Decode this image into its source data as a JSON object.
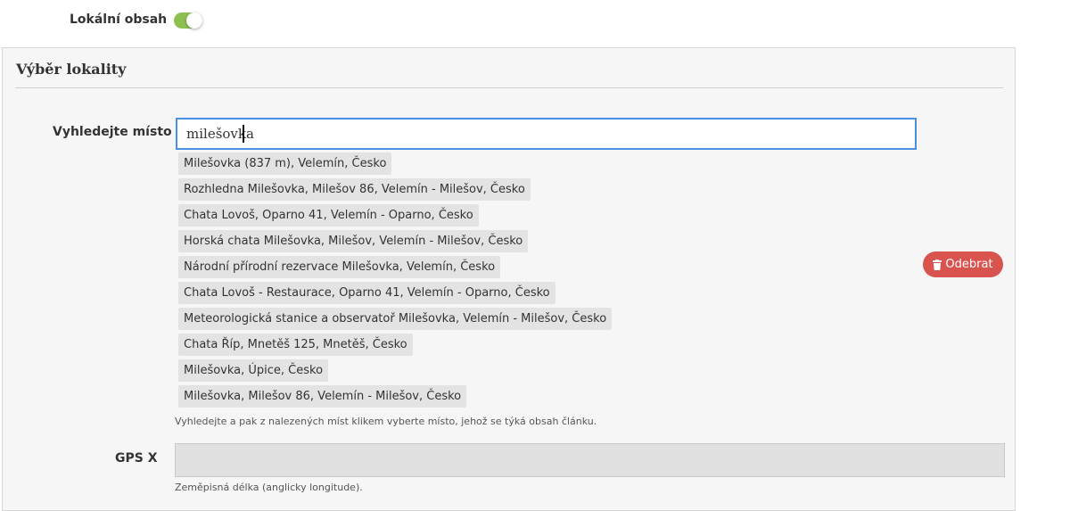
{
  "local_content": {
    "label": "Lokální obsah",
    "enabled": true,
    "accent": "#8cc152"
  },
  "panel": {
    "title": "Výběr lokality"
  },
  "search": {
    "label": "Vyhledejte místo",
    "value": "milešovka",
    "accent": "#4a90e2",
    "suggestions": [
      "Milešovka (837 m), Velemín, Česko",
      "Rozhledna Milešovka, Milešov 86, Velemín - Milešov, Česko",
      "Chata Lovoš, Oparno 41, Velemín - Oparno, Česko",
      "Horská chata Milešovka, Milešov, Velemín - Milešov, Česko",
      "Národní přírodní rezervace Milešovka, Velemín, Česko",
      "Chata Lovoš - Restaurace, Oparno 41, Velemín - Oparno, Česko",
      "Meteorologická stanice a observatoř Milešovka, Velemín - Milešov, Česko",
      "Chata Říp, Mnetěš 125, Mnetěš, Česko",
      "Milešovka, Úpice, Česko",
      "Milešovka, Milešov 86, Velemín - Milešov, Česko"
    ],
    "help": "Vyhledejte a pak z nalezených míst klikem vyberte místo, jehož se týká obsah článku."
  },
  "remove_button": {
    "label": "Odebrat",
    "icon": "trash-icon",
    "color": "#d9534f"
  },
  "gps_x": {
    "label": "GPS X",
    "value": "",
    "help": "Zeměpisná délka (anglicky longitude)."
  }
}
